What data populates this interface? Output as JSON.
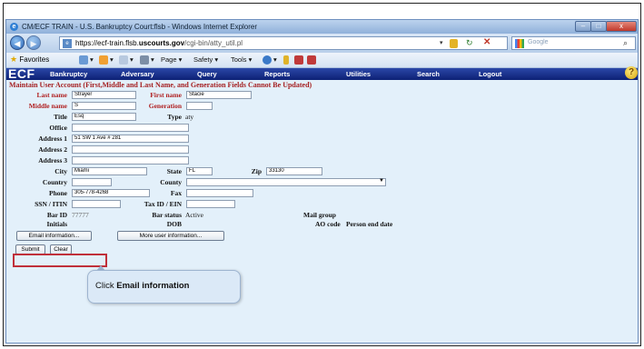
{
  "window": {
    "title": "CM/ECF TRAIN - U.S. Bankruptcy Court:flsb - Windows Internet Explorer",
    "minimize": "–",
    "maximize": "□",
    "close": "x"
  },
  "browser": {
    "url_prefix": "https://ecf-train.flsb.",
    "url_domain": "uscourts.gov",
    "url_path": "/cgi-bin/atty_util.pl",
    "search_placeholder": "Google",
    "favorites_label": "Favorites",
    "commands": {
      "page": "Page ▾",
      "safety": "Safety ▾",
      "tools": "Tools ▾"
    }
  },
  "ecf_nav": {
    "logo": "ECF",
    "items": [
      "Bankruptcy",
      "Adversary",
      "Query",
      "Reports",
      "Utilities",
      "Search",
      "Logout"
    ],
    "help": "?"
  },
  "form": {
    "heading": "Maintain User Account (First,Middle and Last Name, and Generation Fields Cannot Be Updated)",
    "labels": {
      "last_name": "Last name",
      "first_name": "First name",
      "middle_name": "Middle name",
      "generation": "Generation",
      "title": "Title",
      "type": "Type",
      "office": "Office",
      "address1": "Address 1",
      "address2": "Address 2",
      "address3": "Address 3",
      "city": "City",
      "state": "State",
      "zip": "Zip",
      "country": "Country",
      "county": "County",
      "phone": "Phone",
      "fax": "Fax",
      "ssn": "SSN / ITIN",
      "tax_id": "Tax ID / EIN",
      "bar_id": "Bar ID",
      "bar_status": "Bar status",
      "mail_group": "Mail group",
      "initials": "Initials",
      "dob": "DOB",
      "ao_code": "AO code",
      "person_end_date": "Person end date"
    },
    "values": {
      "last_name": "Strayer",
      "first_name": "Stacie",
      "middle_name": "S",
      "generation": "",
      "title": "Esq",
      "type": "aty",
      "office": "",
      "address1": "51 SW 1 Ave # 281",
      "address2": "",
      "address3": "",
      "city": "Miami",
      "state": "FL",
      "zip": "33130",
      "country": "",
      "county": "",
      "phone": "305-778-4268",
      "fax": "",
      "ssn": "",
      "tax_id": "",
      "bar_id": "77777",
      "bar_status": "Active"
    },
    "buttons": {
      "email_info": "Email information...",
      "more_user_info": "More user information...",
      "submit": "Submit",
      "clear": "Clear"
    }
  },
  "callout": {
    "prefix": "Click",
    "emphasis": "Email information"
  }
}
